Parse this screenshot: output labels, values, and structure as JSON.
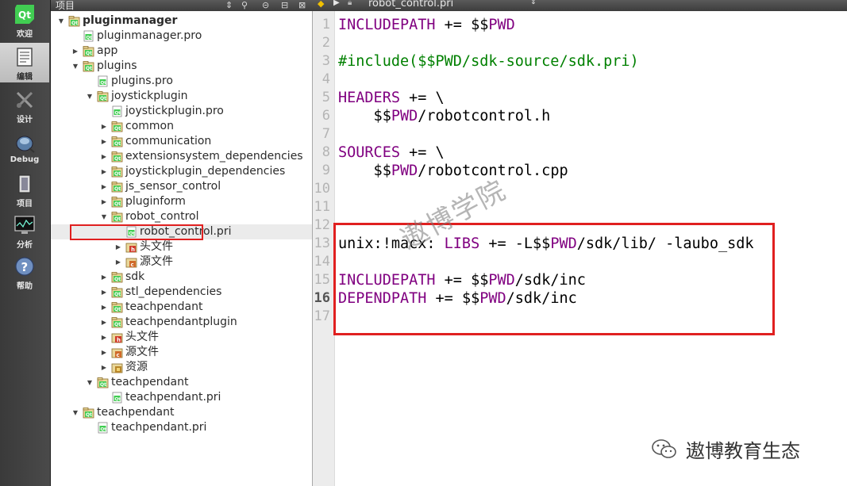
{
  "modebar": {
    "items": [
      {
        "label": "欢迎",
        "icon": "qt-logo-icon",
        "active": false
      },
      {
        "label": "编辑",
        "icon": "edit-document-icon",
        "active": true
      },
      {
        "label": "设计",
        "icon": "design-tools-icon",
        "active": false
      },
      {
        "label": "Debug",
        "icon": "debug-bug-icon",
        "active": false
      },
      {
        "label": "项目",
        "icon": "project-icon",
        "active": false
      },
      {
        "label": "分析",
        "icon": "analyze-monitor-icon",
        "active": false
      },
      {
        "label": "帮助",
        "icon": "help-icon",
        "active": false
      }
    ]
  },
  "project_panel": {
    "title": "项目",
    "tree": [
      {
        "label": "pluginmanager",
        "depth": 0,
        "arrow": "expanded",
        "icon": "folder-project-icon",
        "bold": true
      },
      {
        "label": "pluginmanager.pro",
        "depth": 1,
        "arrow": "none",
        "icon": "pro-file-icon"
      },
      {
        "label": "app",
        "depth": 1,
        "arrow": "collapsed",
        "icon": "folder-project-icon"
      },
      {
        "label": "plugins",
        "depth": 1,
        "arrow": "expanded",
        "icon": "folder-project-icon"
      },
      {
        "label": "plugins.pro",
        "depth": 2,
        "arrow": "none",
        "icon": "pro-file-icon"
      },
      {
        "label": "joystickplugin",
        "depth": 2,
        "arrow": "expanded",
        "icon": "folder-project-icon"
      },
      {
        "label": "joystickplugin.pro",
        "depth": 3,
        "arrow": "none",
        "icon": "pro-file-icon"
      },
      {
        "label": "common",
        "depth": 3,
        "arrow": "collapsed",
        "icon": "folder-project-icon"
      },
      {
        "label": "communication",
        "depth": 3,
        "arrow": "collapsed",
        "icon": "folder-project-icon"
      },
      {
        "label": "extensionsystem_dependencies",
        "depth": 3,
        "arrow": "collapsed",
        "icon": "folder-project-icon"
      },
      {
        "label": "joystickplugin_dependencies",
        "depth": 3,
        "arrow": "collapsed",
        "icon": "folder-project-icon"
      },
      {
        "label": "js_sensor_control",
        "depth": 3,
        "arrow": "collapsed",
        "icon": "folder-project-icon"
      },
      {
        "label": "pluginform",
        "depth": 3,
        "arrow": "collapsed",
        "icon": "folder-project-icon"
      },
      {
        "label": "robot_control",
        "depth": 3,
        "arrow": "expanded",
        "icon": "folder-project-icon"
      },
      {
        "label": "robot_control.pri",
        "depth": 4,
        "arrow": "none",
        "icon": "pri-file-icon",
        "selected": true
      },
      {
        "label": "头文件",
        "depth": 4,
        "arrow": "collapsed",
        "icon": "header-folder-icon"
      },
      {
        "label": "源文件",
        "depth": 4,
        "arrow": "collapsed",
        "icon": "source-folder-icon"
      },
      {
        "label": "sdk",
        "depth": 3,
        "arrow": "collapsed",
        "icon": "folder-project-icon"
      },
      {
        "label": "stl_dependencies",
        "depth": 3,
        "arrow": "collapsed",
        "icon": "folder-project-icon"
      },
      {
        "label": "teachpendant",
        "depth": 3,
        "arrow": "collapsed",
        "icon": "folder-project-icon"
      },
      {
        "label": "teachpendantplugin",
        "depth": 3,
        "arrow": "collapsed",
        "icon": "folder-project-icon"
      },
      {
        "label": "头文件",
        "depth": 3,
        "arrow": "collapsed",
        "icon": "header-folder-icon"
      },
      {
        "label": "源文件",
        "depth": 3,
        "arrow": "collapsed",
        "icon": "source-folder-icon"
      },
      {
        "label": "资源",
        "depth": 3,
        "arrow": "collapsed",
        "icon": "resource-folder-icon"
      },
      {
        "label": "teachpendant",
        "depth": 2,
        "arrow": "expanded",
        "icon": "folder-project-icon"
      },
      {
        "label": "teachpendant.pri",
        "depth": 3,
        "arrow": "none",
        "icon": "pri-file-icon"
      },
      {
        "label": "teachpendant",
        "depth": 1,
        "arrow": "expanded",
        "icon": "folder-project-icon"
      },
      {
        "label": "teachpendant.pri",
        "depth": 2,
        "arrow": "none",
        "icon": "pri-file-icon"
      }
    ]
  },
  "editor": {
    "filename": "robot_control.pri",
    "current_line": 16,
    "lines": [
      [
        {
          "t": "INCLUDEPATH",
          "c": "kw"
        },
        {
          "t": " += $$",
          "c": ""
        },
        {
          "t": "PWD",
          "c": "kw"
        }
      ],
      [],
      [
        {
          "t": "#include($$PWD/sdk-source/sdk.pri)",
          "c": "cm"
        }
      ],
      [],
      [
        {
          "t": "HEADERS",
          "c": "kw"
        },
        {
          "t": " += \\",
          "c": ""
        }
      ],
      [
        {
          "t": "    $$",
          "c": ""
        },
        {
          "t": "PWD",
          "c": "kw"
        },
        {
          "t": "/robotcontrol.h",
          "c": ""
        }
      ],
      [],
      [
        {
          "t": "SOURCES",
          "c": "kw"
        },
        {
          "t": " += \\",
          "c": ""
        }
      ],
      [
        {
          "t": "    $$",
          "c": ""
        },
        {
          "t": "PWD",
          "c": "kw"
        },
        {
          "t": "/robotcontrol.cpp",
          "c": ""
        }
      ],
      [],
      [],
      [],
      [
        {
          "t": "unix:!macx: ",
          "c": ""
        },
        {
          "t": "LIBS",
          "c": "kw"
        },
        {
          "t": " += -L$$",
          "c": ""
        },
        {
          "t": "PWD",
          "c": "kw"
        },
        {
          "t": "/sdk/lib/ -laubo_sdk",
          "c": ""
        }
      ],
      [],
      [
        {
          "t": "INCLUDEPATH",
          "c": "kw"
        },
        {
          "t": " += $$",
          "c": ""
        },
        {
          "t": "PWD",
          "c": "kw"
        },
        {
          "t": "/sdk/inc",
          "c": ""
        }
      ],
      [
        {
          "t": "DEPENDPATH",
          "c": "kw"
        },
        {
          "t": " += $$",
          "c": ""
        },
        {
          "t": "PWD",
          "c": "kw"
        },
        {
          "t": "/sdk/inc",
          "c": ""
        }
      ],
      []
    ]
  },
  "overlay": {
    "watermark": "遨博学院",
    "brand": "遨博教育生态"
  },
  "colors": {
    "keyword": "#800080",
    "comment": "#008000",
    "highlight_border": "#e02020",
    "selection_bg": "#ebebeb"
  }
}
